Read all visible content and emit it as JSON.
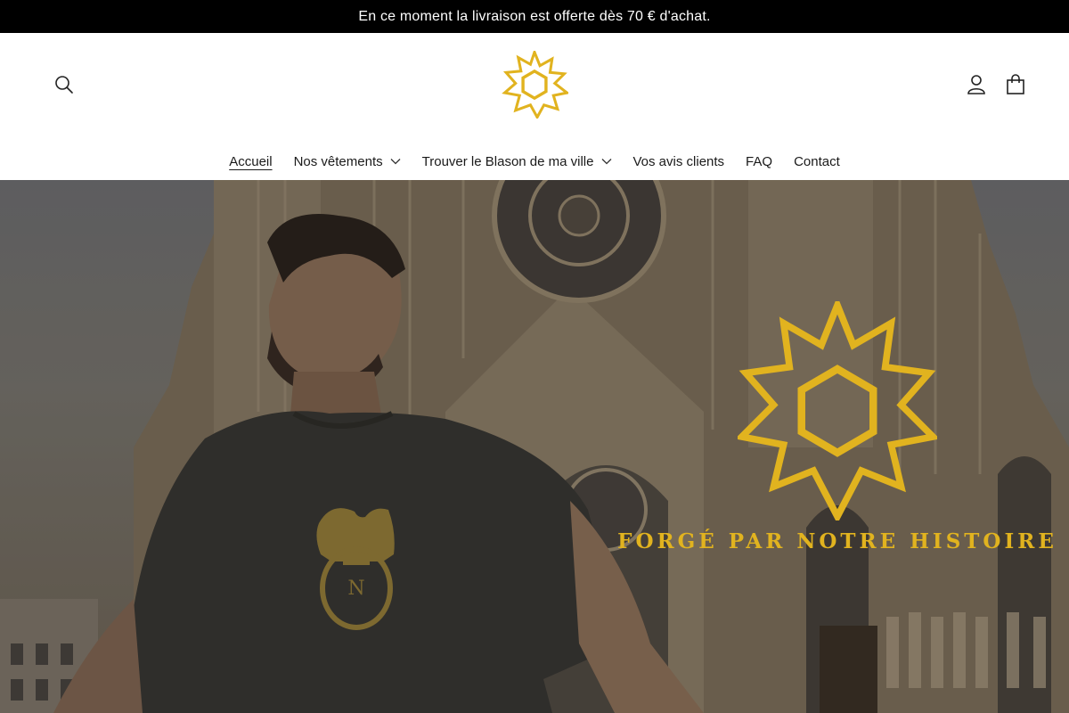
{
  "announcement": {
    "text": "En ce moment la livraison est offerte dès 70 € d'achat."
  },
  "header": {
    "icons": {
      "search": "search-icon",
      "account": "user-icon",
      "cart": "shopping-bag-icon"
    },
    "logo_icon": "star-hexagon-logo"
  },
  "nav": {
    "items": [
      {
        "label": "Accueil",
        "active": true,
        "has_dropdown": false
      },
      {
        "label": "Nos vêtements",
        "active": false,
        "has_dropdown": true
      },
      {
        "label": "Trouver le Blason de ma ville",
        "active": false,
        "has_dropdown": true
      },
      {
        "label": "Vos avis clients",
        "active": false,
        "has_dropdown": false
      },
      {
        "label": "FAQ",
        "active": false,
        "has_dropdown": false
      },
      {
        "label": "Contact",
        "active": false,
        "has_dropdown": false
      }
    ]
  },
  "hero": {
    "tagline": "FORGÉ PAR NOTRE HISTOIRE",
    "shirt_monogram": "N",
    "colors": {
      "gold": "#e1b31f",
      "shirt": "#3a3a36"
    }
  }
}
